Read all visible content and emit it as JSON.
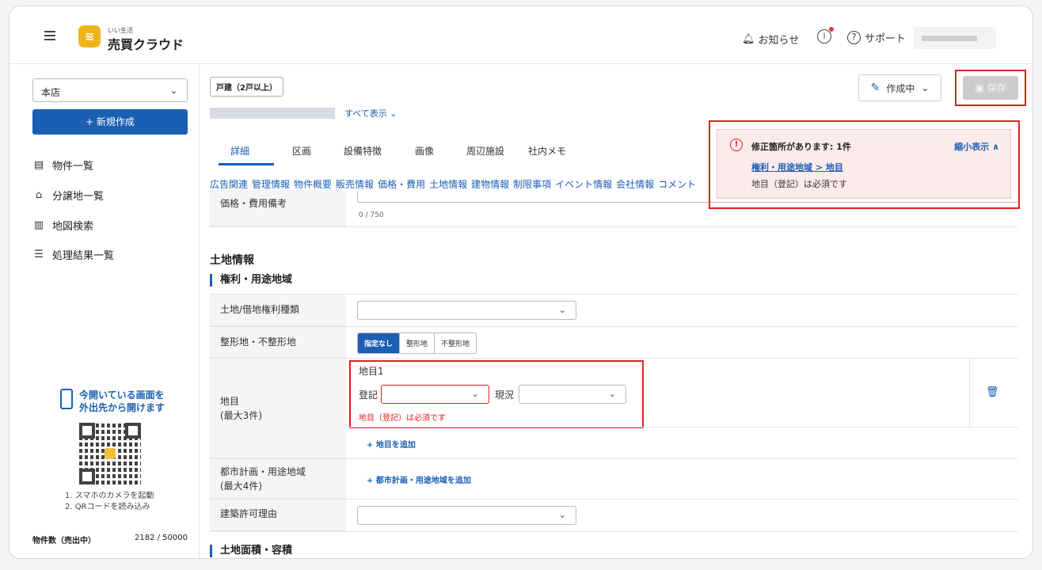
{
  "header": {
    "logo_sub": "いい生活",
    "logo_main": "売買クラウド",
    "notice_label": "お知らせ",
    "support_label": "サポート"
  },
  "sidebar": {
    "store_select": "本店",
    "new_button": "+ 新規作成",
    "nav": [
      {
        "icon": "list-icon",
        "label": "物件一覧"
      },
      {
        "icon": "house-icon",
        "label": "分譲地一覧"
      },
      {
        "icon": "map-icon",
        "label": "地図検索"
      },
      {
        "icon": "checklist-icon",
        "label": "処理結果一覧"
      }
    ],
    "qr_title_1": "今開いている画面を",
    "qr_title_2": "外出先から開けます",
    "qr_step_1": "1. スマホのカメラを起動",
    "qr_step_2": "2. QRコードを読み込み",
    "count_label": "物件数（売出中）",
    "count_value": "2182 / 50000"
  },
  "main": {
    "type_badge": "戸建（2戸以上）",
    "show_all": "すべて表示 ⌄",
    "status": "作成中",
    "save": "保存",
    "tabs": [
      "詳細",
      "区画",
      "設備特徴",
      "画像",
      "周辺施設",
      "社内メモ"
    ],
    "links": [
      "広告関連",
      "管理情報",
      "物件概要",
      "販売情報",
      "価格・費用",
      "土地情報",
      "建物情報",
      "制限事項",
      "イベント情報",
      "会社情報",
      "コメント"
    ],
    "price_remarks_label": "価格・費用備考",
    "price_remarks_count": "0 / 750",
    "section_title": "土地情報",
    "subsection_title": "権利・用途地域",
    "land_rights_label": "土地/借地権利種類",
    "shape_label": "整形地・不整形地",
    "shape_options": [
      "指定なし",
      "整形地",
      "不整形地"
    ],
    "chimoku_label": "地目",
    "chimoku_sub": "(最大3件)",
    "chimoku1": "地目1",
    "registered_label": "登記",
    "current_label": "現況",
    "chimoku_error": "地目（登記）は必須です",
    "add_chimoku": "+ 地目を追加",
    "city_label": "都市計画・用途地域",
    "city_sub": "(最大4件)",
    "add_city": "+ 都市計画・用途地域を追加",
    "building_permit_label": "建築許可理由",
    "next_section": "土地面積・容積"
  },
  "error_panel": {
    "title": "修正箇所があります: 1件",
    "collapse": "縮小表示 ∧",
    "link": "権利・用途地域 > 地目",
    "message": "地目（登記）は必須です"
  },
  "colors": {
    "primary": "#1a5fb4",
    "error": "#e02020",
    "logo": "#f0b31c"
  }
}
